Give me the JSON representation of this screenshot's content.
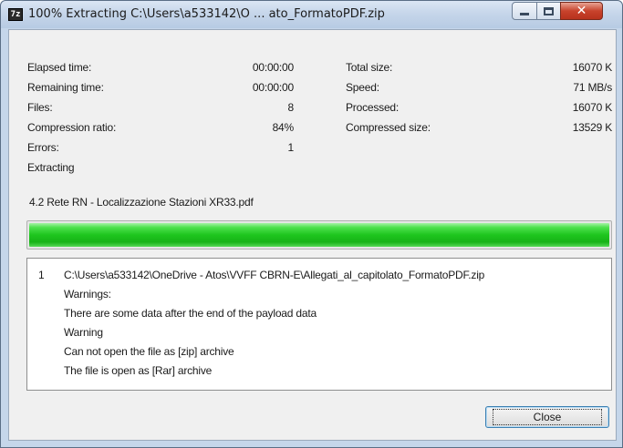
{
  "window": {
    "title": "100% Extracting C:\\Users\\a533142\\O ... ato_FormatoPDF.zip",
    "app_icon_text": "7z"
  },
  "stats": {
    "elapsed_label": "Elapsed time:",
    "elapsed_value": "00:00:00",
    "remaining_label": "Remaining time:",
    "remaining_value": "00:00:00",
    "files_label": "Files:",
    "files_value": "8",
    "ratio_label": "Compression ratio:",
    "ratio_value": "84%",
    "errors_label": "Errors:",
    "errors_value": "1",
    "total_label": "Total size:",
    "total_value": "16070 K",
    "speed_label": "Speed:",
    "speed_value": "71 MB/s",
    "processed_label": "Processed:",
    "processed_value": "16070 K",
    "compressed_label": "Compressed size:",
    "compressed_value": "13529 K"
  },
  "status": {
    "operation": "Extracting",
    "current_file": "4.2 Rete RN - Localizzazione  Stazioni XR33.pdf"
  },
  "progress": {
    "percent": 100,
    "color": "#1ec51e"
  },
  "log": {
    "index": "1",
    "path": "C:\\Users\\a533142\\OneDrive - Atos\\VVFF CBRN-E\\Allegati_al_capitolato_FormatoPDF.zip",
    "lines": [
      "Warnings:",
      "There are some data after the end of the payload data",
      "Warning",
      "Can not open the file as [zip] archive",
      "The file is open as [Rar] archive"
    ]
  },
  "buttons": {
    "close_label": "Close"
  }
}
